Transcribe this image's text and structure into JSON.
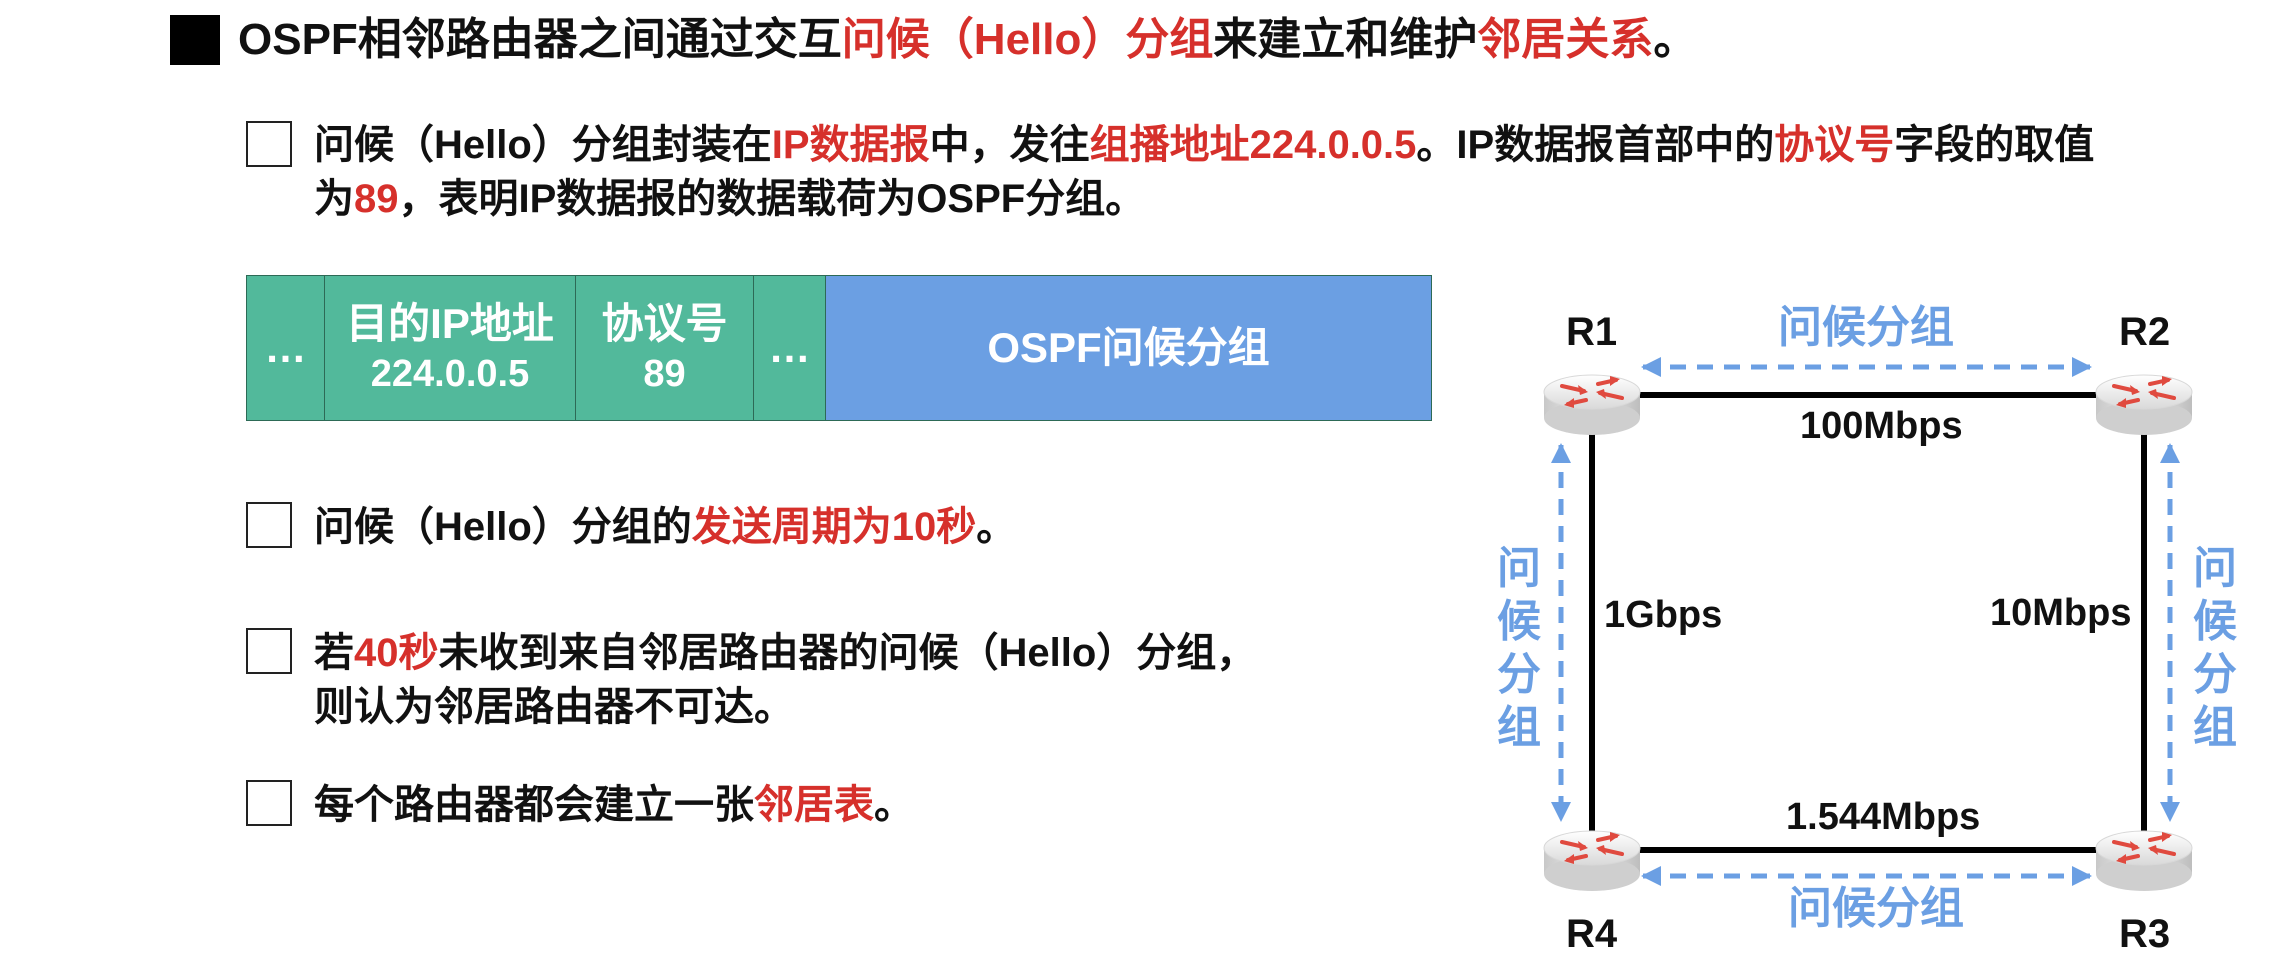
{
  "title": {
    "p1": "OSPF相邻路由器之间通过交互",
    "r1": "问候（Hello）分组",
    "p2": "来建立和维护",
    "r2": "邻居关系",
    "p3": "。"
  },
  "bullet1": {
    "line1": {
      "p1": "问候（Hello）分组封装在",
      "r1": "IP数据报",
      "p2": "中，发往",
      "r2": "组播地址224.0.0.5",
      "p3": "。IP数据报首部中的",
      "r3": "协议号",
      "p4": "字段的取值"
    },
    "line2": {
      "p1": "为",
      "r1": "89",
      "p2": "，表明IP数据报的数据载荷为OSPF分组。"
    }
  },
  "packet": {
    "dots1": "…",
    "dest_label": "目的IP地址",
    "dest_value": "224.0.0.5",
    "proto_label": "协议号",
    "proto_value": "89",
    "dots2": "…",
    "payload": "OSPF问候分组"
  },
  "bullet2": {
    "p1": "问候（Hello）分组的",
    "r1": "发送周期为10秒",
    "p2": "。"
  },
  "bullet3": {
    "line1": {
      "p1": "若",
      "r1": "40秒",
      "p2": "未收到来自邻居路由器的问候（Hello）分组，"
    },
    "line2": "则认为邻居路由器不可达。"
  },
  "bullet4": {
    "p1": "每个路由器都会建立一张",
    "r1": "邻居表",
    "p2": "。"
  },
  "network": {
    "routers": [
      "R1",
      "R2",
      "R3",
      "R4"
    ],
    "links": {
      "r1_r2": "100Mbps",
      "r2_r3": "10Mbps",
      "r3_r4": "1.544Mbps",
      "r4_r1": "1Gbps"
    },
    "hello_top": "问候分组",
    "hello_bottom": "问候分组",
    "hello_left": [
      "问",
      "候",
      "分",
      "组"
    ],
    "hello_right": [
      "问",
      "候",
      "分",
      "组"
    ],
    "colors": {
      "router_arrow": "#e04a3f",
      "hello": "#6b9fe3",
      "link": "#000000"
    }
  }
}
